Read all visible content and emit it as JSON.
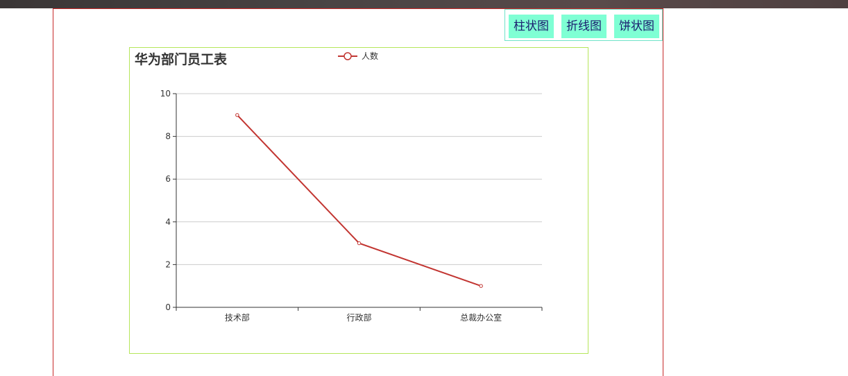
{
  "toolbar": {
    "bar_label": "柱状图",
    "line_label": "折线图",
    "pie_label": "饼状图"
  },
  "colors": {
    "series": "#c23531",
    "button_bg": "#7fffd4",
    "chart_border": "#b5e65a",
    "page_border": "#c62828"
  },
  "chart_data": {
    "type": "line",
    "title": "华为部门员工表",
    "categories": [
      "技术部",
      "行政部",
      "总裁办公室"
    ],
    "series": [
      {
        "name": "人数",
        "values": [
          9,
          3,
          1
        ]
      }
    ],
    "ylim": [
      0,
      10
    ],
    "yticks": [
      0,
      2,
      4,
      6,
      8,
      10
    ],
    "grid": true,
    "legend": "top-center"
  }
}
